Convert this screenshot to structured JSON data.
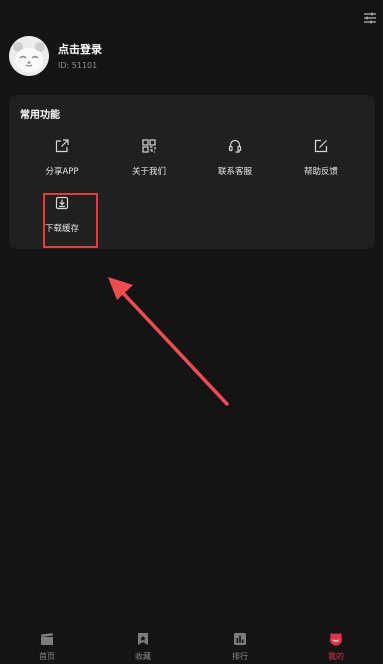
{
  "header": {
    "settings_icon": "sliders-icon"
  },
  "profile": {
    "login_title": "点击登录",
    "user_id": "ID: 51101",
    "avatar_icon": "panda-avatar"
  },
  "functions": {
    "title": "常用功能",
    "items": [
      {
        "label": "分享APP",
        "icon": "share-icon"
      },
      {
        "label": "关于我们",
        "icon": "qr-grid-icon"
      },
      {
        "label": "联系客服",
        "icon": "headset-icon"
      },
      {
        "label": "帮助反馈",
        "icon": "edit-icon"
      },
      {
        "label": "下载缓存",
        "icon": "download-icon"
      }
    ]
  },
  "annotation": {
    "highlight_color": "#e8393b",
    "arrow_color": "#ef4c4f"
  },
  "tabbar": {
    "items": [
      {
        "label": "首页",
        "icon": "clapperboard-icon"
      },
      {
        "label": "收藏",
        "icon": "bookmark-star-icon"
      },
      {
        "label": "排行",
        "icon": "ranking-chart-icon"
      },
      {
        "label": "我的",
        "icon": "user-face-icon",
        "active": true
      }
    ],
    "active_color": "#e8334a"
  }
}
